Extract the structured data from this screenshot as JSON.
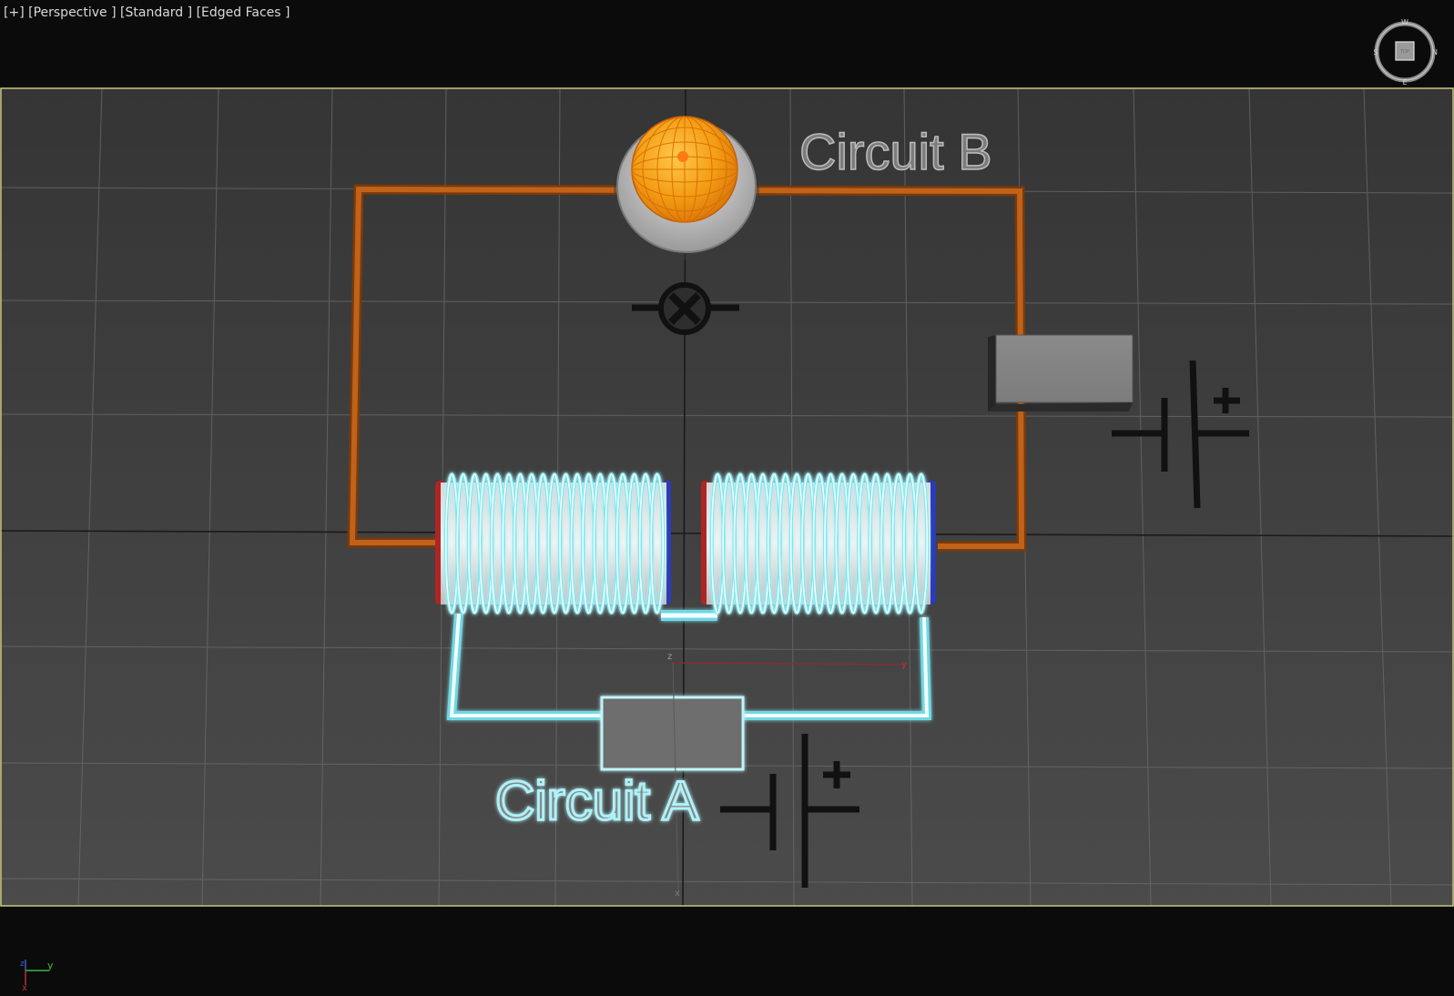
{
  "viewport": {
    "labels": [
      "[+]",
      "[Perspective ]",
      "[Standard ]",
      "[Edged Faces ]"
    ]
  },
  "viewcube": {
    "face_label": "TOP",
    "compass": {
      "north": "N",
      "south": "S",
      "east": "E",
      "west": "W"
    }
  },
  "scene": {
    "circuit_b_label": "Circuit B",
    "circuit_a_label": "Circuit A",
    "battery_plus": "+",
    "gizmo_axes": {
      "x": "x",
      "y": "y",
      "z": "z"
    }
  },
  "axis_tripod": {
    "x": "x",
    "y": "y",
    "z": "z"
  },
  "colors": {
    "background": "#0b0b0b",
    "grid_floor_top": "#353535",
    "grid_floor_bottom": "#4b4b4b",
    "viewport_border": "#c9c67a",
    "wire_orange": "#b55a14",
    "wire_cyan": "#7de9f2",
    "coil_white": "#f4ffff",
    "bulb_orange": "#f3a21a",
    "red_pole": "#b02424",
    "blue_pole": "#2a3cb8"
  }
}
